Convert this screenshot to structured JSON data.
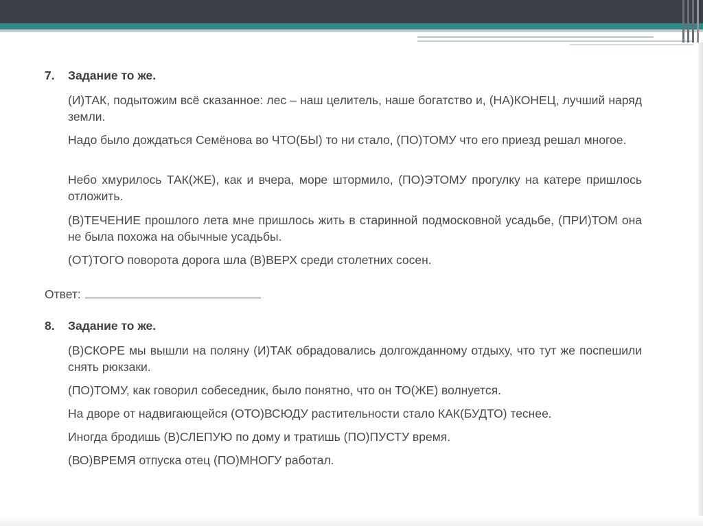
{
  "task7": {
    "number": "7.",
    "title": "Задание то же.",
    "sentences": [
      "(И)ТАК, подытожим всё сказанное: лес – наш целитель, наше богатство и, (НА)КОНЕЦ, лучший наряд земли.",
      "Надо было дождаться Семёнова во ЧТО(БЫ) то ни стало, (ПО)ТОМУ что его приезд решал многое.",
      "Небо хмурилось ТАК(ЖЕ), как и вчера, море штормило, (ПО)ЭТОМУ прогулку на катере пришлось отложить.",
      "(В)ТЕЧЕНИЕ прошлого лета мне пришлось жить в старинной подмосковной усадьбе, (ПРИ)ТОМ она не была похожа на обычные усадьбы.",
      "(ОТ)ТОГО поворота дорога шла (В)ВЕРХ среди столетних сосен."
    ]
  },
  "answer_label": "Ответ:",
  "task8": {
    "number": "8.",
    "title": "Задание то же.",
    "sentences": [
      "(В)СКОРЕ мы вышли на поляну (И)ТАК обрадовались долгожданному отдыху, что тут же поспешили снять рюкзаки.",
      "(ПО)ТОМУ, как говорил собеседник, было понятно, что он ТО(ЖЕ) волнуется.",
      "На дворе от надвигающейся (ОТО)ВСЮДУ растительности стало КАК(БУДТО) теснее.",
      "Иногда бродишь (В)СЛЕПУЮ по дому и тратишь (ПО)ПУСТУ время.",
      "(ВО)ВРЕМЯ отпуска отец (ПО)МНОГУ работал."
    ]
  }
}
